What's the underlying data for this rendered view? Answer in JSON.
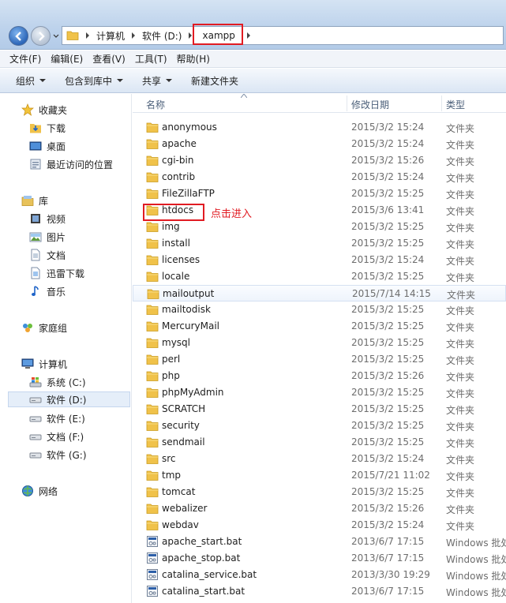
{
  "address": {
    "crumbs": [
      "计算机",
      "软件 (D:)",
      "xampp"
    ]
  },
  "menu": [
    "文件(F)",
    "编辑(E)",
    "查看(V)",
    "工具(T)",
    "帮助(H)"
  ],
  "commands": [
    {
      "label": "组织",
      "dropdown": true
    },
    {
      "label": "包含到库中",
      "dropdown": true
    },
    {
      "label": "共享",
      "dropdown": true
    },
    {
      "label": "新建文件夹",
      "dropdown": false
    }
  ],
  "nav": {
    "favorites": {
      "label": "收藏夹",
      "items": [
        "下载",
        "桌面",
        "最近访问的位置"
      ]
    },
    "libraries": {
      "label": "库",
      "items": [
        "视频",
        "图片",
        "文档",
        "迅雷下载",
        "音乐"
      ]
    },
    "homegroup": {
      "label": "家庭组"
    },
    "computer": {
      "label": "计算机",
      "items": [
        "系统 (C:)",
        "软件 (D:)",
        "软件 (E:)",
        "文档 (F:)",
        "软件 (G:)"
      ]
    },
    "network": {
      "label": "网络"
    }
  },
  "columns": {
    "name": "名称",
    "date": "修改日期",
    "type": "类型"
  },
  "files": [
    {
      "name": "anonymous",
      "date": "2015/3/2 15:24",
      "type": "文件夹",
      "kind": "folder"
    },
    {
      "name": "apache",
      "date": "2015/3/2 15:24",
      "type": "文件夹",
      "kind": "folder"
    },
    {
      "name": "cgi-bin",
      "date": "2015/3/2 15:26",
      "type": "文件夹",
      "kind": "folder"
    },
    {
      "name": "contrib",
      "date": "2015/3/2 15:24",
      "type": "文件夹",
      "kind": "folder"
    },
    {
      "name": "FileZillaFTP",
      "date": "2015/3/2 15:25",
      "type": "文件夹",
      "kind": "folder"
    },
    {
      "name": "htdocs",
      "date": "2015/3/6 13:41",
      "type": "文件夹",
      "kind": "folder"
    },
    {
      "name": "img",
      "date": "2015/3/2 15:25",
      "type": "文件夹",
      "kind": "folder"
    },
    {
      "name": "install",
      "date": "2015/3/2 15:25",
      "type": "文件夹",
      "kind": "folder"
    },
    {
      "name": "licenses",
      "date": "2015/3/2 15:24",
      "type": "文件夹",
      "kind": "folder"
    },
    {
      "name": "locale",
      "date": "2015/3/2 15:25",
      "type": "文件夹",
      "kind": "folder"
    },
    {
      "name": "mailoutput",
      "date": "2015/7/14 14:15",
      "type": "文件夹",
      "kind": "folder"
    },
    {
      "name": "mailtodisk",
      "date": "2015/3/2 15:25",
      "type": "文件夹",
      "kind": "folder"
    },
    {
      "name": "MercuryMail",
      "date": "2015/3/2 15:25",
      "type": "文件夹",
      "kind": "folder"
    },
    {
      "name": "mysql",
      "date": "2015/3/2 15:25",
      "type": "文件夹",
      "kind": "folder"
    },
    {
      "name": "perl",
      "date": "2015/3/2 15:25",
      "type": "文件夹",
      "kind": "folder"
    },
    {
      "name": "php",
      "date": "2015/3/2 15:26",
      "type": "文件夹",
      "kind": "folder"
    },
    {
      "name": "phpMyAdmin",
      "date": "2015/3/2 15:25",
      "type": "文件夹",
      "kind": "folder"
    },
    {
      "name": "SCRATCH",
      "date": "2015/3/2 15:25",
      "type": "文件夹",
      "kind": "folder"
    },
    {
      "name": "security",
      "date": "2015/3/2 15:25",
      "type": "文件夹",
      "kind": "folder"
    },
    {
      "name": "sendmail",
      "date": "2015/3/2 15:25",
      "type": "文件夹",
      "kind": "folder"
    },
    {
      "name": "src",
      "date": "2015/3/2 15:24",
      "type": "文件夹",
      "kind": "folder"
    },
    {
      "name": "tmp",
      "date": "2015/7/21 11:02",
      "type": "文件夹",
      "kind": "folder"
    },
    {
      "name": "tomcat",
      "date": "2015/3/2 15:25",
      "type": "文件夹",
      "kind": "folder"
    },
    {
      "name": "webalizer",
      "date": "2015/3/2 15:26",
      "type": "文件夹",
      "kind": "folder"
    },
    {
      "name": "webdav",
      "date": "2015/3/2 15:24",
      "type": "文件夹",
      "kind": "folder"
    },
    {
      "name": "apache_start.bat",
      "date": "2013/6/7 17:15",
      "type": "Windows 批处",
      "kind": "bat"
    },
    {
      "name": "apache_stop.bat",
      "date": "2013/6/7 17:15",
      "type": "Windows 批处",
      "kind": "bat"
    },
    {
      "name": "catalina_service.bat",
      "date": "2013/3/30 19:29",
      "type": "Windows 批处",
      "kind": "bat"
    },
    {
      "name": "catalina_start.bat",
      "date": "2013/6/7 17:15",
      "type": "Windows 批处",
      "kind": "bat"
    }
  ],
  "annotation": "点击进入",
  "colors": {
    "highlight": "#e11b22",
    "folder": "#f0c24a",
    "selected_bg": "#e5eef9"
  }
}
